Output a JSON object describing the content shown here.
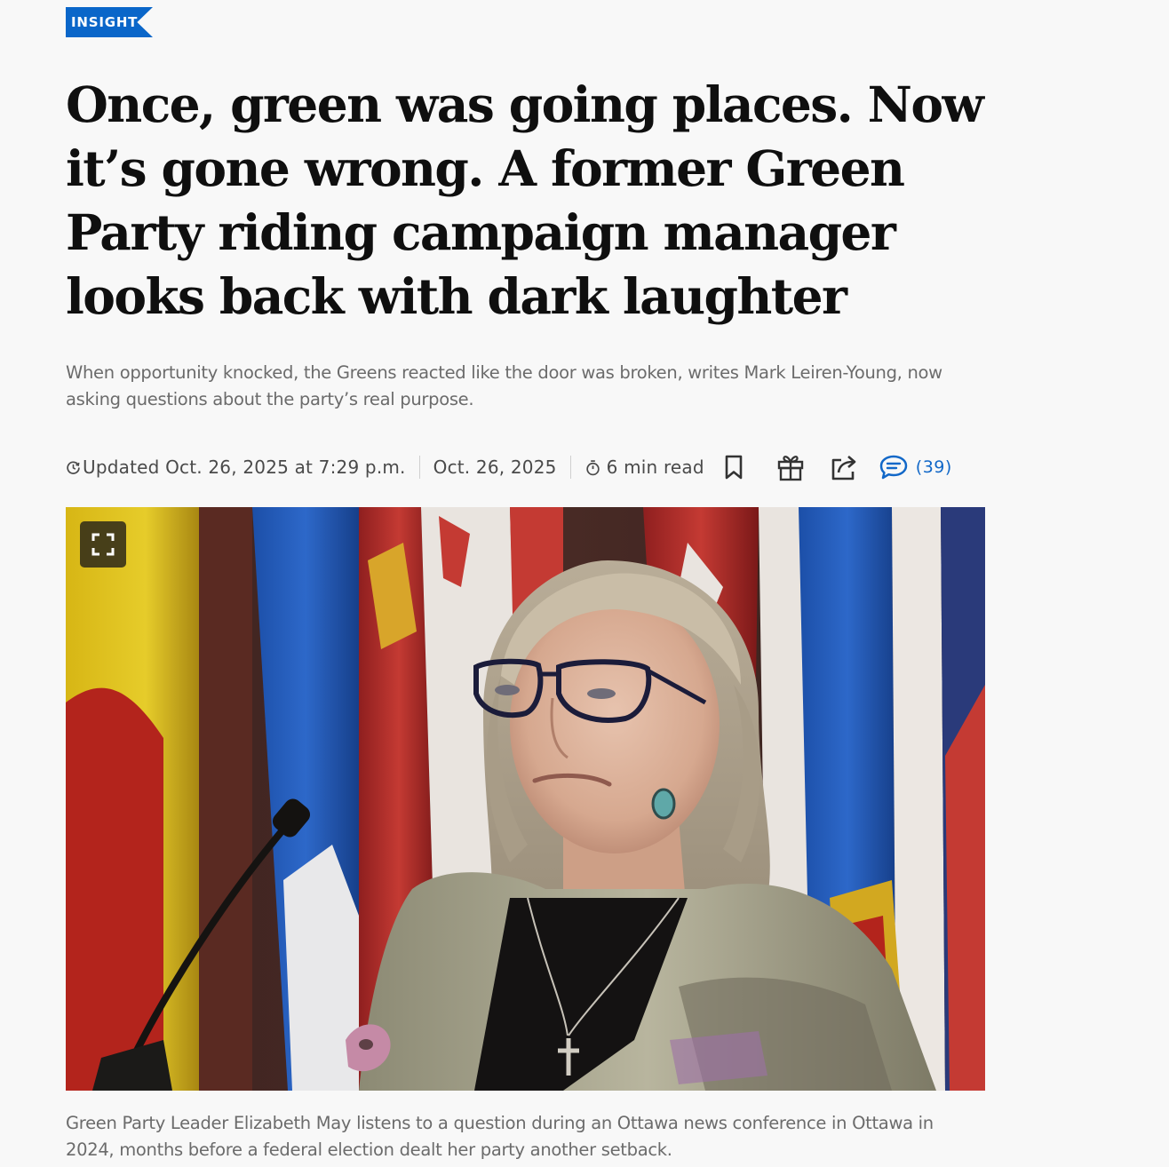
{
  "article": {
    "section_tag": "INSIGHT",
    "headline": "Once, green was going places. Now it’s gone wrong. A former Green Party riding campaign manager looks back with dark laughter",
    "dek": "When opportunity knocked, the Greens reacted like the door was broken, writes Mark Leiren-Young, now asking questions about the party’s real purpose.",
    "meta": {
      "updated": "Updated Oct. 26, 2025 at 7:29 p.m.",
      "published": "Oct. 26, 2025",
      "read_time": "6 min read",
      "comment_count": "(39)"
    },
    "photo_caption": "Green Party Leader Elizabeth May listens to a question during an Ottawa news conference in Ottawa in 2024, months before a federal election dealt her party another setback."
  },
  "icons": {
    "updated": "clock-icon",
    "read_time": "timer-icon",
    "actions": [
      "bookmark-icon",
      "gift-icon",
      "share-icon",
      "comment-icon"
    ],
    "photo": "expand-icon"
  },
  "colors": {
    "accent": "#0a66c9",
    "background": "#f8f8f8",
    "headline": "#0f0f0f",
    "muted_text": "#6b6b6b",
    "comment_link": "#1268c8"
  }
}
